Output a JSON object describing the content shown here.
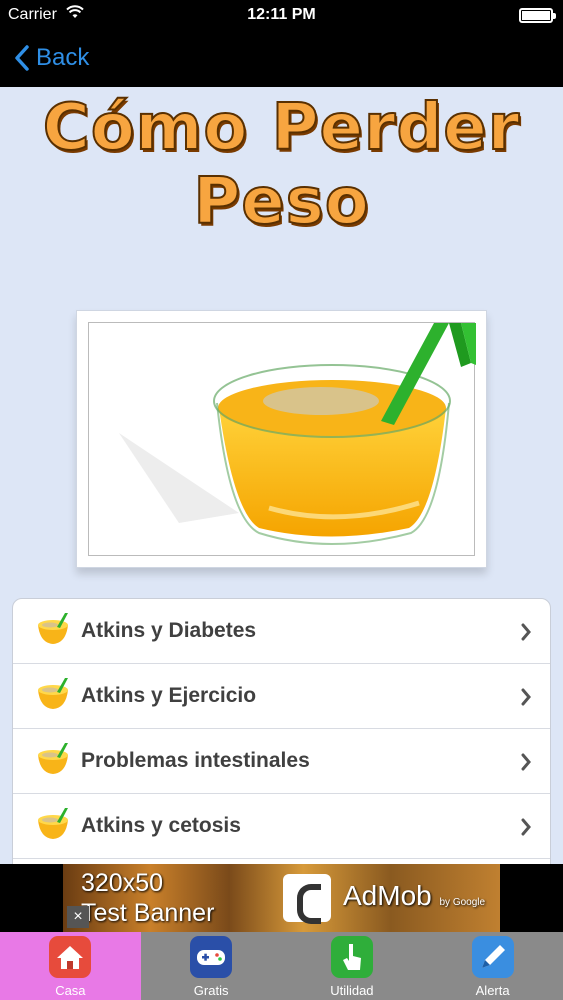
{
  "status_bar": {
    "carrier": "Carrier",
    "time": "12:11 PM"
  },
  "nav": {
    "back_label": "Back"
  },
  "title": {
    "line1": "Cómo Perder",
    "line2": "Peso"
  },
  "list": {
    "items": [
      {
        "label": "Atkins y Diabetes"
      },
      {
        "label": "Atkins y Ejercicio"
      },
      {
        "label": " Problemas intestinales"
      },
      {
        "label": "Atkins y cetosis"
      }
    ]
  },
  "ad": {
    "line1": "320x50",
    "line2": "Test Banner",
    "brand": "AdMob",
    "brand_sub": "by Google",
    "close": "×"
  },
  "tabs": [
    {
      "label": "Casa",
      "icon": "house-icon",
      "active": true
    },
    {
      "label": "Gratis",
      "icon": "gamepad-icon",
      "active": false
    },
    {
      "label": "Utilidad",
      "icon": "hand-pointer-icon",
      "active": false
    },
    {
      "label": "Alerta",
      "icon": "pen-icon",
      "active": false
    }
  ],
  "colors": {
    "nav_bg": "#000000",
    "back_blue": "#2f8fe6",
    "page_bg": "#dde6f6",
    "title_orange": "#f7a540",
    "active_tab": "#e879e6",
    "tab_bar": "#8a8a8a"
  }
}
